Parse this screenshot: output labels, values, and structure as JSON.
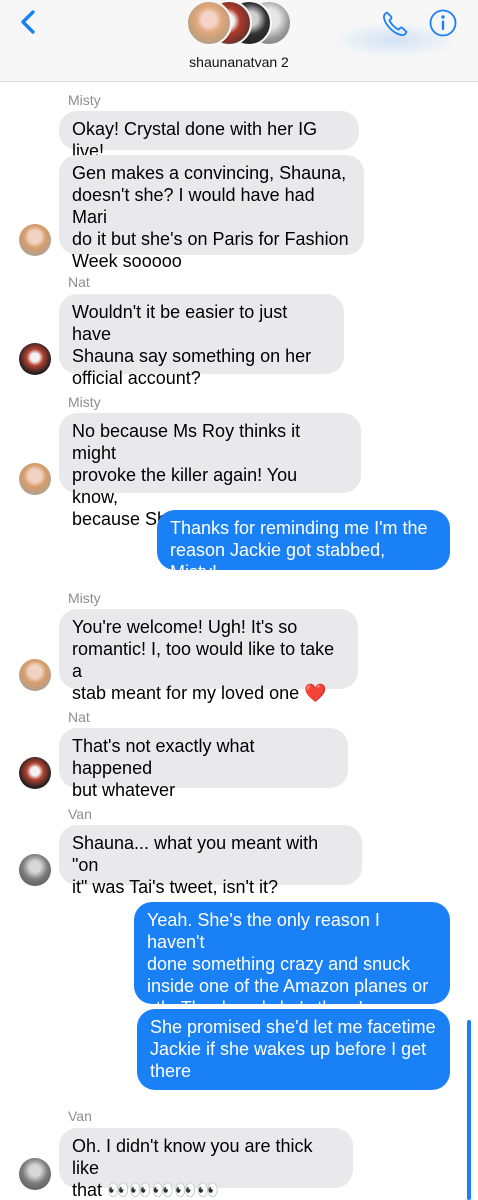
{
  "header": {
    "group_name": "shaunanatvan 2"
  },
  "colors": {
    "accent": "#1a80f5",
    "incoming_bubble": "#e9e9eb",
    "header_bg": "#f7f7f7",
    "meta_text": "#8e8e93"
  },
  "icons": [
    "chevron-left-icon",
    "phone-icon",
    "info-icon"
  ],
  "messages": [
    {
      "sender": "Misty"
    },
    {
      "text": "Okay! Crystal done with her IG live!"
    },
    {
      "text": "Gen makes a convincing, Shauna,\ndoesn't she? I would have had Mari\ndo it but she's on Paris for Fashion\nWeek sooooo"
    },
    {
      "sender": "Nat"
    },
    {
      "text": "Wouldn't it be easier to just have\nShauna say something on her\nofficial account?"
    },
    {
      "sender": "Misty"
    },
    {
      "text": "No because Ms Roy thinks it might\nprovoke the killer again! You know,\nbecause Shauna is def the target!"
    },
    {
      "text": "Thanks for reminding me I'm the\nreason Jackie got stabbed, Misty!"
    },
    {
      "sender": "Misty"
    },
    {
      "text": "You're welcome! Ugh! It's so\nromantic! I, too would like to take a\nstab meant for my loved one ❤️"
    },
    {
      "sender": "Nat"
    },
    {
      "text": "That's not exactly what happened\nbut whatever"
    },
    {
      "sender": "Van"
    },
    {
      "text": "Shauna... what you meant with \"on\nit\" was Tai's tweet, isn't it?"
    },
    {
      "text": "Yeah. She's the only reason I haven't\ndone something crazy and snuck\ninside one of the Amazon planes or\nsth. Thank god she's there!"
    },
    {
      "text": "She promised she'd let me facetime\nJackie if she wakes up before I get\nthere"
    },
    {
      "sender": "Van"
    },
    {
      "text": "Oh. I didn't know you are thick like\nthat 👀👀👀👀👀"
    }
  ]
}
